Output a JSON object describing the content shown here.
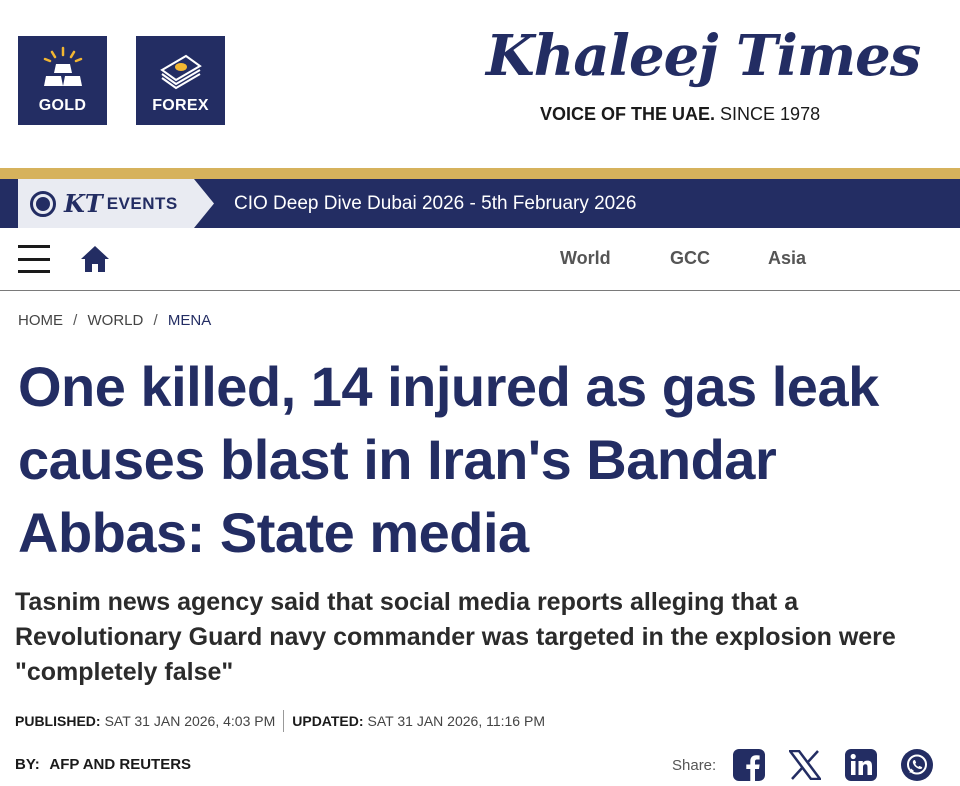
{
  "header": {
    "tiles": [
      {
        "label": "GOLD",
        "icon": "gold-bars-icon"
      },
      {
        "label": "FOREX",
        "icon": "banknotes-icon"
      }
    ],
    "logo_text": "Khaleej Times",
    "tagline_bold": "VOICE OF THE UAE.",
    "tagline_rest": " SINCE 1978"
  },
  "events": {
    "badge_mark": "KT",
    "badge_word": "EVENTS",
    "title": "CIO Deep Dive Dubai 2026 - 5th February 2026"
  },
  "nav": {
    "links": [
      "World",
      "GCC",
      "Asia"
    ]
  },
  "breadcrumb": {
    "items": [
      "HOME",
      "WORLD",
      "MENA"
    ],
    "separator": "/"
  },
  "article": {
    "headline": "One killed, 14 injured as gas leak causes blast in Iran's Bandar Abbas: State media",
    "summary": "Tasnim news agency said that social media reports alleging that a Revolutionary Guard navy commander was targeted in the explosion were \"completely false\"",
    "published_label": "PUBLISHED:",
    "published_value": "SAT 31 JAN 2026, 4:03 PM",
    "updated_label": "UPDATED:",
    "updated_value": "SAT 31 JAN 2026, 11:16 PM",
    "by_label": "BY:",
    "authors": "AFP AND REUTERS"
  },
  "share": {
    "label": "Share:",
    "networks": [
      "facebook-icon",
      "x-icon",
      "linkedin-icon",
      "whatsapp-icon"
    ]
  },
  "colors": {
    "brand_navy": "#232d63",
    "gold_stripe": "#d6b25c",
    "badge_bg": "#e9ebf2"
  }
}
